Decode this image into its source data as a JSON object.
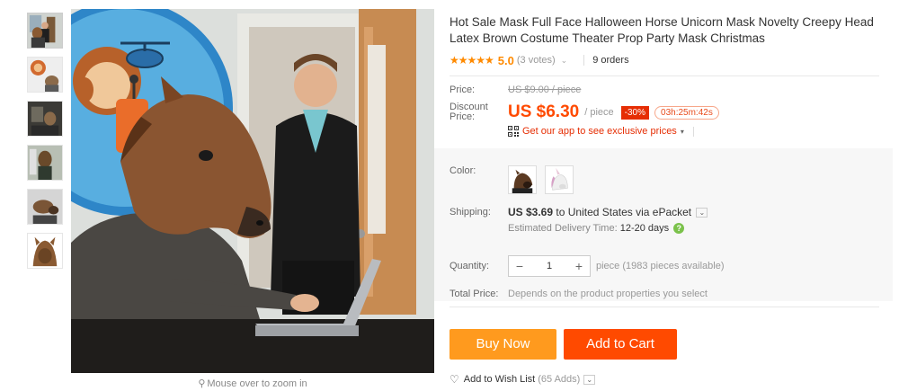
{
  "thumbnails": [
    {
      "name": "thumb-office-man-standing"
    },
    {
      "name": "thumb-monkey-poster"
    },
    {
      "name": "thumb-office-dark"
    },
    {
      "name": "thumb-mask-front"
    },
    {
      "name": "thumb-mask-side"
    },
    {
      "name": "thumb-mask-top"
    }
  ],
  "gallery": {
    "zoom_hint": "Mouse over to zoom in"
  },
  "product": {
    "title": "Hot Sale Mask Full Face Halloween Horse Unicorn Mask Novelty Creepy Head Latex Brown Costume Theater Prop Party Mask Christmas",
    "stars": "★★★★★",
    "rating": "5.0",
    "votes": "(3 votes)",
    "rating_chevron": "⌄",
    "orders": "9 orders"
  },
  "pricing": {
    "price_label": "Price:",
    "old_price": "US $9.00 / piece",
    "discount_label_1": "Discount",
    "discount_label_2": "Price:",
    "new_price": "US $6.30",
    "per_unit": "/ piece",
    "discount_badge": "-30%",
    "timer": "03h:25m:42s",
    "app_promo": "Get our app to see exclusive prices",
    "app_chevron": "▾"
  },
  "options": {
    "color_label": "Color:",
    "colors": [
      "Brown horse",
      "White unicorn"
    ]
  },
  "shipping": {
    "label": "Shipping:",
    "cost": "US $3.69",
    "destination": " to United States via ePacket",
    "dropdown": "⌄",
    "delivery_prefix": "Estimated Delivery Time: ",
    "delivery_days": "12-20 days",
    "help": "?"
  },
  "quantity": {
    "label": "Quantity:",
    "minus": "−",
    "value": "1",
    "plus": "+",
    "note": "piece (1983 pieces available)"
  },
  "total": {
    "label": "Total Price:",
    "value": "Depends on the product properties you select"
  },
  "actions": {
    "buy_now": "Buy Now",
    "add_to_cart": "Add to Cart",
    "wish_link": "Add to Wish List",
    "wish_count": "(65 Adds)",
    "wish_dropdown": "⌄"
  },
  "colors": {
    "accent_orange": "#ff9a1e",
    "accent_red": "#ff4a00",
    "star": "#ff8a00"
  }
}
